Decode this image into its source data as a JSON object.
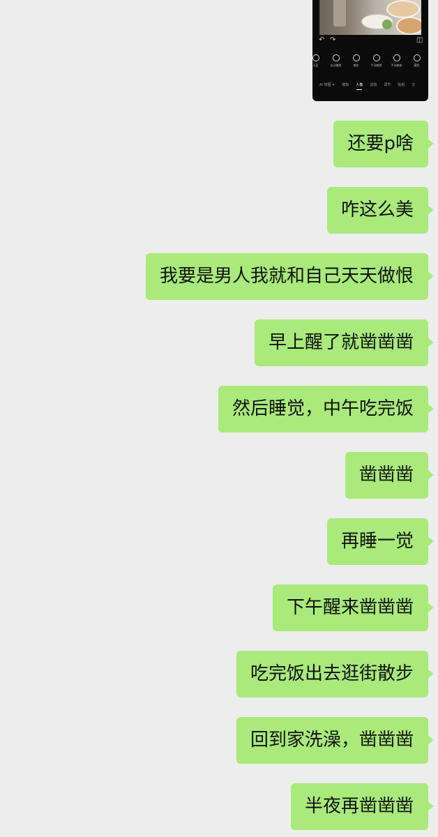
{
  "shared_image": {
    "tools": [
      {
        "label": "天蓝",
        "icon": "sky-icon"
      },
      {
        "label": "自动美颜",
        "icon": "auto-beauty-icon"
      },
      {
        "label": "美妆",
        "icon": "makeup-icon"
      },
      {
        "label": "手动美颜",
        "icon": "manual-beauty-icon"
      },
      {
        "label": "手动美体",
        "icon": "body-shape-icon"
      },
      {
        "label": "瘦脸",
        "icon": "face-slim-icon"
      }
    ],
    "tabs": [
      "AI 修图 ✦",
      "模板",
      "人像",
      "滤镜",
      "调节",
      "贴纸",
      "文"
    ],
    "active_tab_index": 2
  },
  "messages": [
    {
      "text": "还要p啥",
      "sender": "self"
    },
    {
      "text": "咋这么美",
      "sender": "self"
    },
    {
      "text": "我要是男人我就和自己天天做恨",
      "sender": "self"
    },
    {
      "text": "早上醒了就凿凿凿",
      "sender": "self"
    },
    {
      "text": "然后睡觉，中午吃完饭",
      "sender": "self"
    },
    {
      "text": "凿凿凿",
      "sender": "self"
    },
    {
      "text": "再睡一觉",
      "sender": "self"
    },
    {
      "text": "下午醒来凿凿凿",
      "sender": "self"
    },
    {
      "text": "吃完饭出去逛街散步",
      "sender": "self"
    },
    {
      "text": "回到家洗澡，凿凿凿",
      "sender": "self"
    },
    {
      "text": "半夜再凿凿凿",
      "sender": "self"
    }
  ],
  "colors": {
    "background": "#ededed",
    "self_bubble": "#a9ea7a",
    "text": "#111111"
  }
}
